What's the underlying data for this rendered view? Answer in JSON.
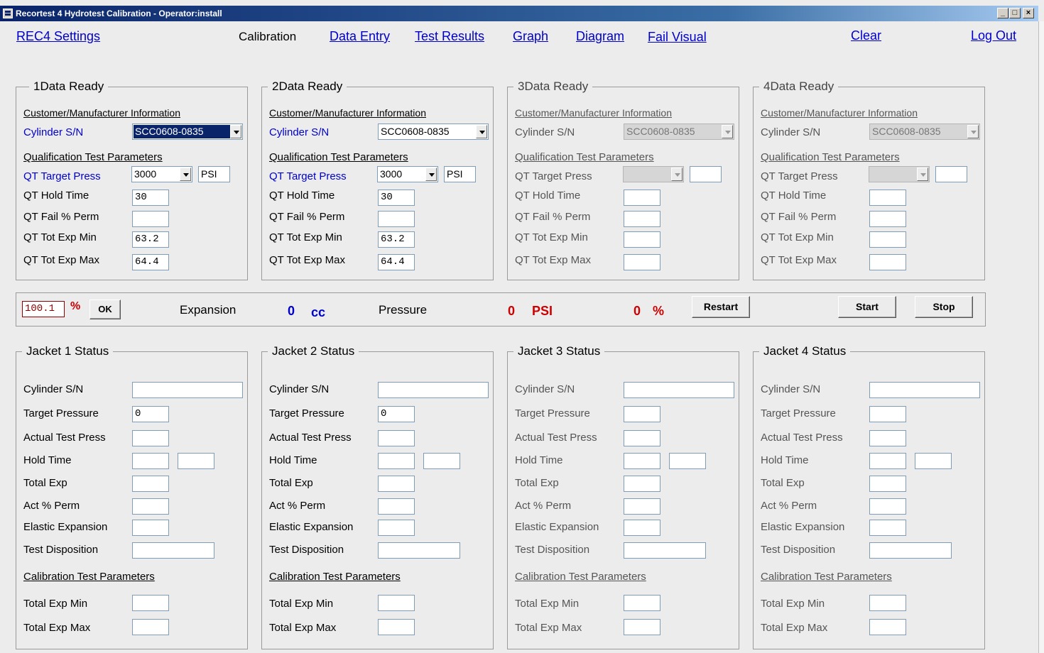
{
  "window": {
    "title": "Recortest 4 Hydrotest Calibration - Operator:install",
    "min_glyph": "_",
    "max_glyph": "□",
    "close_glyph": "×"
  },
  "menu": {
    "settings": "REC4 Settings",
    "calibration": "Calibration",
    "data_entry": "Data Entry",
    "test_results": "Test Results",
    "graph": "Graph",
    "diagram": "Diagram",
    "fail_visual": "Fail Visual",
    "clear": "Clear",
    "logout": "Log Out"
  },
  "labels": {
    "cust_info": "Customer/Manufacturer Information",
    "cyl_sn": "Cylinder S/N",
    "qt_params": "Qualification Test Parameters",
    "qt_target_press": "QT Target Press",
    "qt_hold_time": "QT Hold Time",
    "qt_fail_perm": "QT Fail % Perm",
    "qt_tot_exp_min": "QT Tot Exp Min",
    "qt_tot_exp_max": "QT Tot Exp Max",
    "j_cyl_sn": "Cylinder S/N",
    "j_target_pressure": "Target Pressure",
    "j_actual_test_press": "Actual Test Press",
    "j_hold_time": "Hold Time",
    "j_total_exp": "Total Exp",
    "j_act_perm": "Act % Perm",
    "j_elastic": "Elastic Expansion",
    "j_disposition": "Test Disposition",
    "cal_params": "Calibration Test Parameters",
    "cal_min": "Total Exp Min",
    "cal_max": "Total Exp Max"
  },
  "stations": [
    {
      "title": "1Data Ready",
      "cyl_sn": "SCC0608-0835",
      "target_press": "3000",
      "unit": "PSI",
      "hold_time": "30",
      "fail_perm": "",
      "tot_exp_min": "63.2",
      "tot_exp_max": "64.4",
      "enabled": true
    },
    {
      "title": "2Data Ready",
      "cyl_sn": "SCC0608-0835",
      "target_press": "3000",
      "unit": "PSI",
      "hold_time": "30",
      "fail_perm": "",
      "tot_exp_min": "63.2",
      "tot_exp_max": "64.4",
      "enabled": true
    },
    {
      "title": "3Data Ready",
      "cyl_sn": "SCC0608-0835",
      "target_press": "",
      "unit": "",
      "hold_time": "",
      "fail_perm": "",
      "tot_exp_min": "",
      "tot_exp_max": "",
      "enabled": false
    },
    {
      "title": "4Data Ready",
      "cyl_sn": "SCC0608-0835",
      "target_press": "",
      "unit": "",
      "hold_time": "",
      "fail_perm": "",
      "tot_exp_min": "",
      "tot_exp_max": "",
      "enabled": false
    }
  ],
  "controls": {
    "percent_value": "100.1",
    "percent_sign": "%",
    "ok": "OK",
    "expansion_label": "Expansion",
    "expansion_value": "0",
    "expansion_unit": "cc",
    "pressure_label": "Pressure",
    "pressure_value": "0",
    "pressure_unit": "PSI",
    "pressure_pct_value": "0",
    "pressure_pct_unit": "%",
    "restart": "Restart",
    "start": "Start",
    "stop": "Stop"
  },
  "jackets": [
    {
      "title": "Jacket 1 Status",
      "target_pressure": "0"
    },
    {
      "title": "Jacket 2 Status",
      "target_pressure": "0"
    },
    {
      "title": "Jacket 3 Status",
      "target_pressure": ""
    },
    {
      "title": "Jacket 4 Status",
      "target_pressure": ""
    }
  ],
  "colors": {
    "link": "#0000cc",
    "title_bar": "#0a246a",
    "pressure_red": "#cc0000",
    "expansion_blue": "#0000cc"
  }
}
